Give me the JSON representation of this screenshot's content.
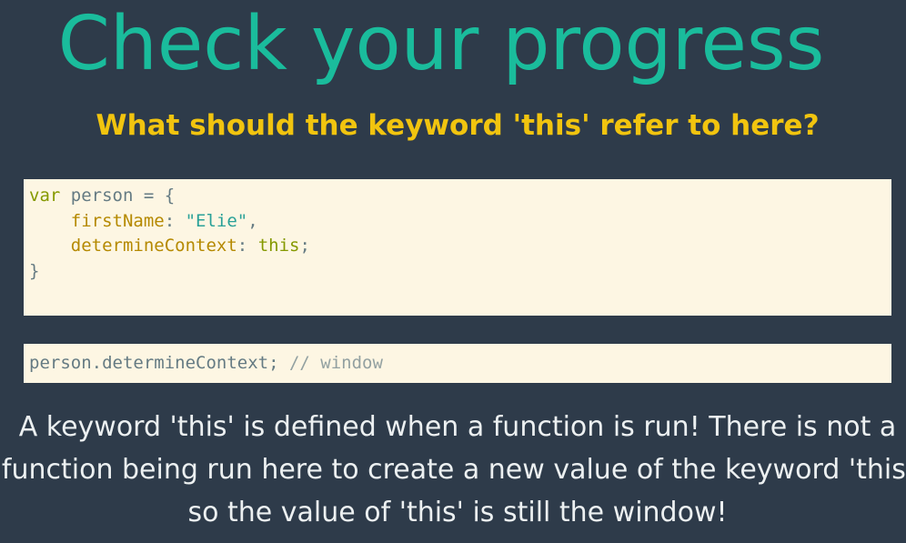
{
  "slide": {
    "title": "Check your progress",
    "question": "What should the keyword 'this' refer to here?",
    "explanation": "A keyword 'this' is defined when a function is run! There is not a function being run here to create a new value of the keyword 'this' so the value of 'this' is still the window!"
  },
  "code_main": {
    "line1_kw": "var",
    "line1_rest": " person = {",
    "line2_indent": "    ",
    "line2_prop": "firstName",
    "line2_sep": ": ",
    "line2_str": "\"Elie\"",
    "line2_end": ",",
    "line3_indent": "    ",
    "line3_prop": "determineContext",
    "line3_sep": ": ",
    "line3_kw": "this",
    "line3_end": ";",
    "line4": "}"
  },
  "code_call": {
    "expr": "person.determineContext; ",
    "comment": "// window"
  },
  "colors": {
    "background": "#2e3b4a",
    "title": "#1abc9c",
    "question": "#f1c40f",
    "text": "#ecf0f1",
    "code_bg": "#fdf6e3"
  }
}
